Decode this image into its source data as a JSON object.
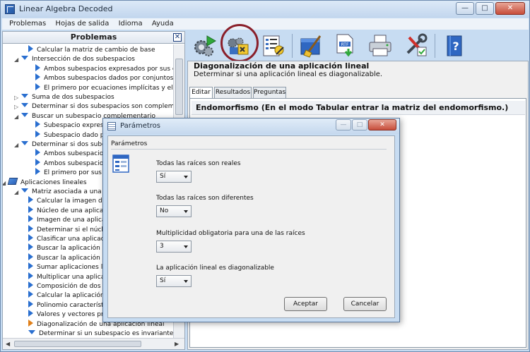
{
  "window": {
    "title": "Linear Algebra Decoded",
    "min": "—",
    "max": "□",
    "close": "✕"
  },
  "menu": [
    "Problemas",
    "Hojas de salida",
    "Idioma",
    "Ayuda"
  ],
  "left_panel": {
    "title": "Problemas",
    "close": "✕",
    "tree": [
      {
        "label": "Calcular la matriz de cambio de base",
        "icon": "arrow-right-icon"
      },
      {
        "label": "Intersección de dos subespacios",
        "icon": "arrow-down-icon"
      },
      {
        "label": "Ambos subespacios expresados por sus ecu",
        "icon": "arrow-right-icon"
      },
      {
        "label": "Ambos subespacios dados por conjuntos ge",
        "icon": "arrow-right-icon"
      },
      {
        "label": "El primero por ecuaciones implícitas y el segu",
        "icon": "arrow-right-icon"
      },
      {
        "label": "Suma de dos subespacios",
        "icon": "arrow-down-icon"
      },
      {
        "label": "Determinar si dos subespacios son complementa",
        "icon": "arrow-down-icon"
      },
      {
        "label": "Buscar un subespacio complementario",
        "icon": "arrow-down-icon"
      },
      {
        "label": "Subespacio expres",
        "icon": "arrow-right-icon"
      },
      {
        "label": "Subespacio dado p",
        "icon": "arrow-right-icon"
      },
      {
        "label": "Determinar si dos sube",
        "icon": "arrow-down-icon"
      },
      {
        "label": "Ambos subespacio",
        "icon": "arrow-right-icon"
      },
      {
        "label": "Ambos subespacio",
        "icon": "arrow-right-icon"
      },
      {
        "label": "El primero por sus",
        "icon": "arrow-right-icon"
      },
      {
        "label": "Aplicaciones lineales",
        "icon": "book-icon"
      },
      {
        "label": "Matriz asociada a una a",
        "icon": "arrow-down-icon"
      },
      {
        "label": "Calcular la imagen de u",
        "icon": "arrow-right-icon"
      },
      {
        "label": "Núcleo de una aplicació",
        "icon": "arrow-right-icon"
      },
      {
        "label": "Imagen de una aplicació",
        "icon": "arrow-right-icon"
      },
      {
        "label": "Determinar si el núcleo",
        "icon": "arrow-right-icon"
      },
      {
        "label": "Clasificar una aplicació",
        "icon": "arrow-right-icon"
      },
      {
        "label": "Buscar la aplicación line",
        "icon": "arrow-right-icon"
      },
      {
        "label": "Buscar la aplicación line",
        "icon": "arrow-right-icon"
      },
      {
        "label": "Sumar aplicaciones line",
        "icon": "arrow-right-icon"
      },
      {
        "label": "Multiplicar una aplicació",
        "icon": "arrow-right-icon"
      },
      {
        "label": "Composición de dos apl",
        "icon": "arrow-right-icon"
      },
      {
        "label": "Calcular la aplicación li",
        "icon": "arrow-right-icon"
      },
      {
        "label": "Polinomio característico",
        "icon": "arrow-right-icon"
      },
      {
        "label": "Valores y vectores pro",
        "icon": "arrow-right-icon"
      },
      {
        "label": "Diagonalización de una aplicación lineal",
        "icon": "arrow-right-orange-icon"
      },
      {
        "label": "Determinar si un subespacio es invariante",
        "icon": "arrow-down-icon"
      }
    ]
  },
  "content": {
    "title": "Diagonalización de una aplicación lineal",
    "subtitle": "Determinar si una aplicación lineal es diagonalizable.",
    "tabs": [
      "Editar",
      "Resultados",
      "Preguntas"
    ],
    "section": "Endomorfismo (En el modo Tabular entrar la matriz del endomorfismo.)"
  },
  "dialog": {
    "title": "Parámetros",
    "group": "Parámetros",
    "fields": [
      {
        "label": "Todas las raíces son reales",
        "value": "Sí"
      },
      {
        "label": "Todas las raíces son diferentes",
        "value": "No"
      },
      {
        "label": "Multiplicidad obligatoria para una de las raíces",
        "value": "3"
      },
      {
        "label": "La aplicación lineal es diagonalizable",
        "value": "Sí"
      }
    ],
    "accept": "Aceptar",
    "cancel": "Cancelar"
  },
  "colors": {
    "highlight_ring": "#8a1f2a",
    "tree_arrow": "#2a6fd0",
    "selected_arrow": "#e0801a"
  }
}
